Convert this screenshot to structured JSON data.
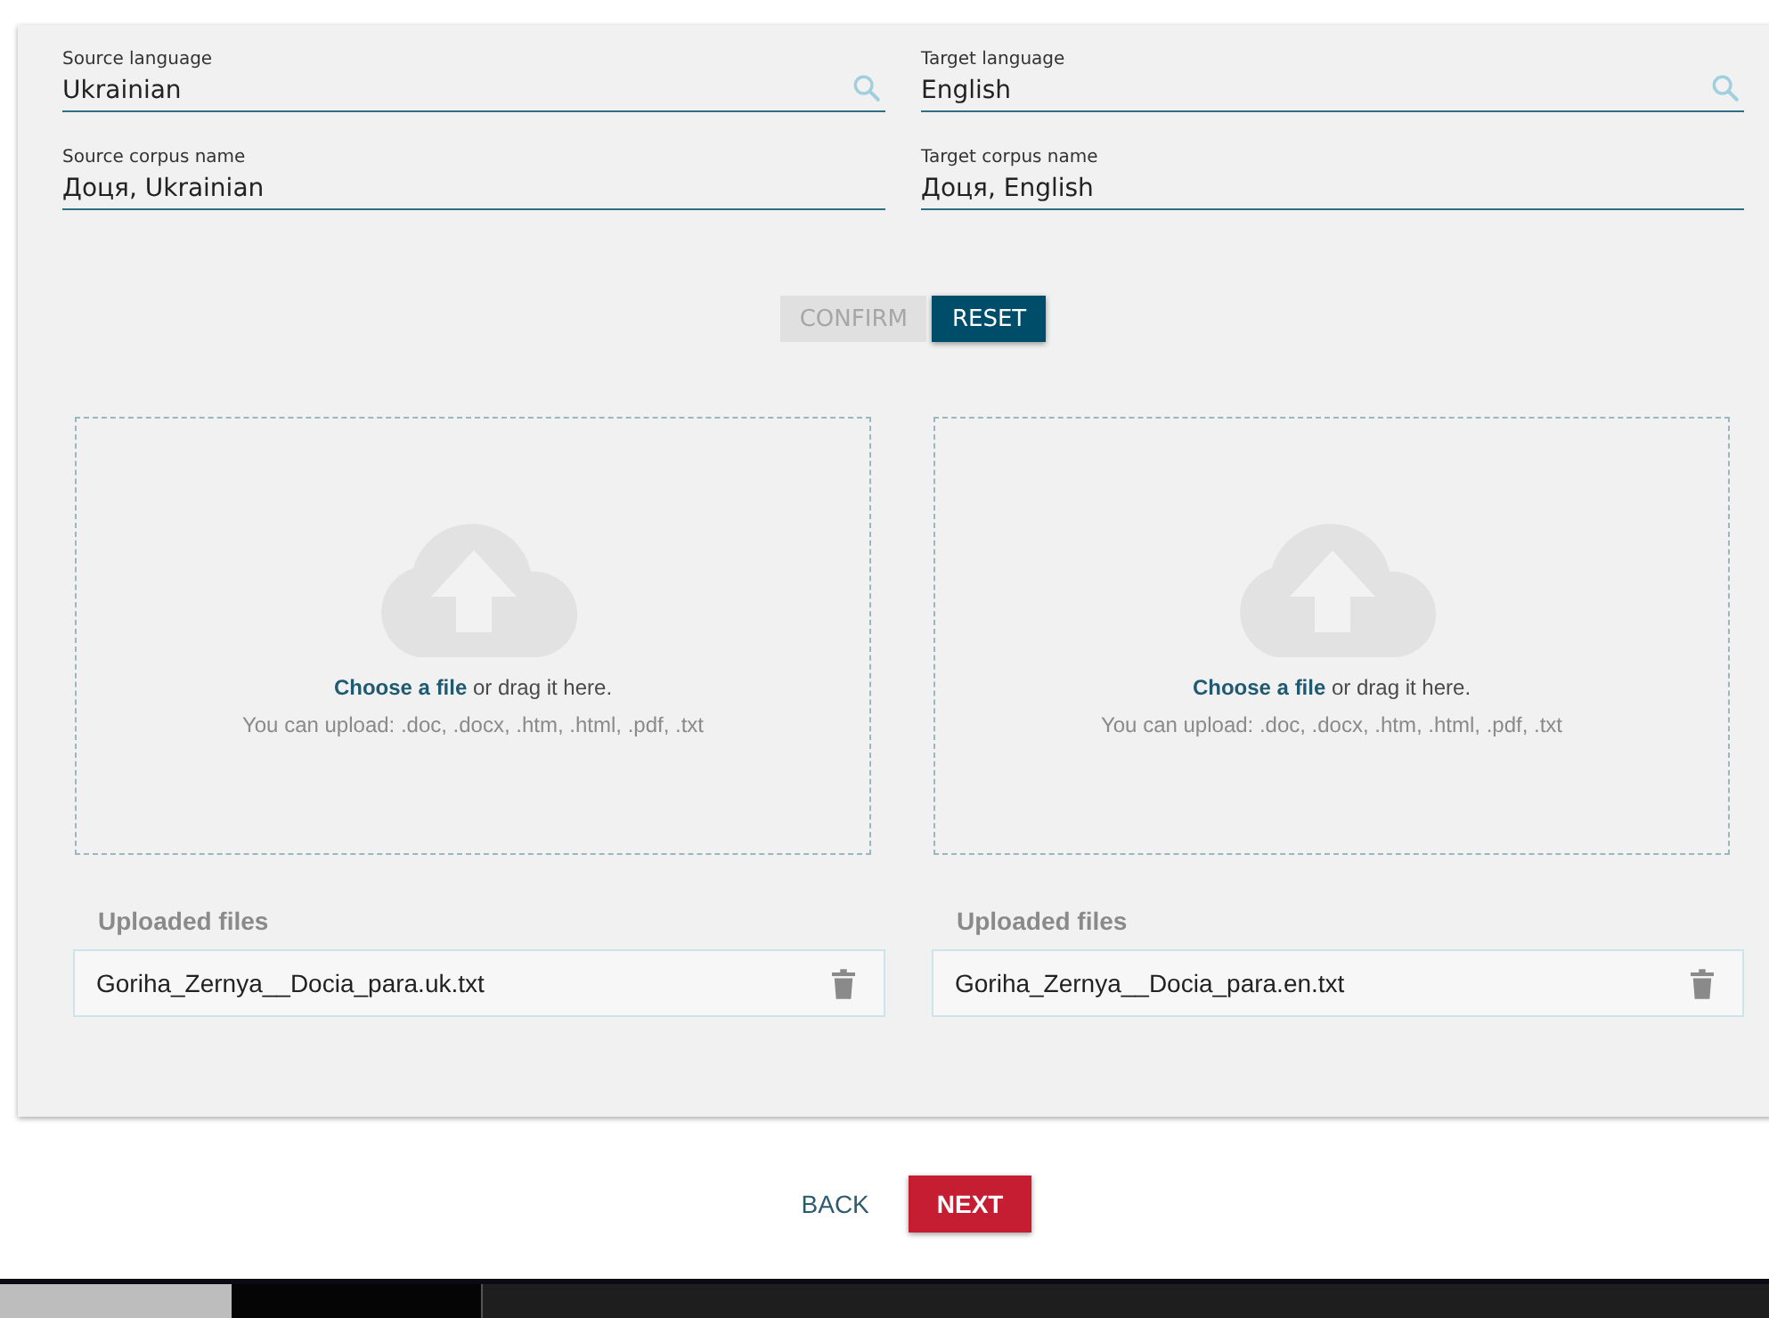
{
  "fields": [
    {
      "label": "Source language",
      "value": "Ukrainian",
      "kind": "search"
    },
    {
      "label": "Target language",
      "value": "English",
      "kind": "search"
    },
    {
      "label": "Source corpus name",
      "value": "Доця, Ukrainian",
      "kind": "text"
    },
    {
      "label": "Target corpus name",
      "value": "Доця, English",
      "kind": "text"
    }
  ],
  "actions": [
    {
      "label": "CONFIRM",
      "disabled": true
    },
    {
      "label": "RESET",
      "disabled": false
    }
  ],
  "uploads": [
    {
      "prompt": "**Choose a file** or drag it here.",
      "formats": "You can upload: .doc, .docx, .htm, .html, .pdf, .txt",
      "files_heading": "Uploaded files",
      "files": [
        "Goriha_Zernya__Docia_para.uk.txt"
      ]
    },
    {
      "prompt": "**Choose a file** or drag it here.",
      "formats": "You can upload: .doc, .docx, .htm, .html, .pdf, .txt",
      "files_heading": "Uploaded files",
      "files": [
        "Goriha_Zernya__Docia_para.en.txt"
      ]
    }
  ],
  "navigation": [
    {
      "label": "BACK",
      "kind": "text"
    },
    {
      "label": "NEXT",
      "kind": "primary"
    }
  ]
}
